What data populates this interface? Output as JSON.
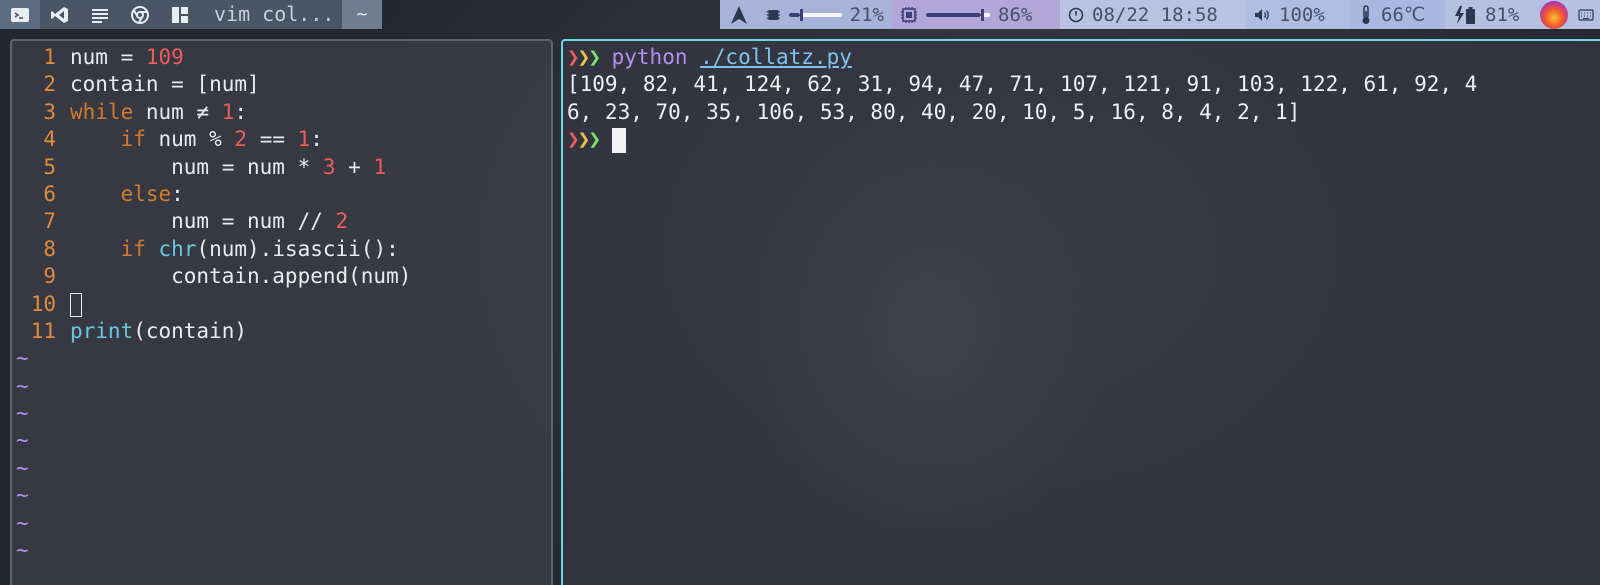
{
  "topbar": {
    "left_icons": [
      "terminal-icon",
      "vscode-icon",
      "notes-icon",
      "chrome-icon",
      "layout-icon"
    ],
    "window_title": "vim col...",
    "home_label": "~",
    "mem_percent": "21%",
    "mem_level": 0.21,
    "cpu_percent": "86%",
    "cpu_level": 0.86,
    "datetime": "08/22 18:58",
    "volume": "100%",
    "temperature": "66℃",
    "battery": "81%"
  },
  "vim": {
    "lines": [
      {
        "n": "1",
        "tokens": [
          [
            "",
            "num = "
          ],
          [
            "num",
            "109"
          ]
        ]
      },
      {
        "n": "2",
        "tokens": [
          [
            "",
            "contain = [num]"
          ]
        ]
      },
      {
        "n": "3",
        "tokens": [
          [
            "kw",
            "while"
          ],
          [
            "",
            " num ≠ "
          ],
          [
            "num",
            "1"
          ],
          [
            "",
            ":"
          ]
        ]
      },
      {
        "n": "4",
        "tokens": [
          [
            "",
            "    "
          ],
          [
            "kw",
            "if"
          ],
          [
            "",
            " num % "
          ],
          [
            "num",
            "2"
          ],
          [
            "",
            " == "
          ],
          [
            "num",
            "1"
          ],
          [
            "",
            ":"
          ]
        ]
      },
      {
        "n": "5",
        "tokens": [
          [
            "",
            "        num = num * "
          ],
          [
            "num",
            "3"
          ],
          [
            "",
            " + "
          ],
          [
            "num",
            "1"
          ]
        ]
      },
      {
        "n": "6",
        "tokens": [
          [
            "",
            "    "
          ],
          [
            "kw",
            "else"
          ],
          [
            "",
            ":"
          ]
        ]
      },
      {
        "n": "7",
        "tokens": [
          [
            "",
            "        num = num // "
          ],
          [
            "num",
            "2"
          ]
        ]
      },
      {
        "n": "8",
        "tokens": [
          [
            "",
            "    "
          ],
          [
            "kw",
            "if"
          ],
          [
            "",
            " "
          ],
          [
            "fn",
            "chr"
          ],
          [
            "",
            "(num).isascii():"
          ]
        ]
      },
      {
        "n": "9",
        "tokens": [
          [
            "",
            "        contain.append(num)"
          ]
        ]
      },
      {
        "n": "10",
        "tokens": [
          [
            "cursor",
            ""
          ]
        ]
      },
      {
        "n": "11",
        "tokens": [
          [
            "fn",
            "print"
          ],
          [
            "",
            "(contain)"
          ]
        ]
      }
    ],
    "tilde_lines": [
      "~",
      "~",
      "~",
      "~",
      "~",
      "~",
      "~",
      "~"
    ]
  },
  "terminal": {
    "prompt": "❯❯❯",
    "command": "python",
    "argument": "./collatz.py",
    "output_line1": "[109, 82, 41, 124, 62, 31, 94, 47, 71, 107, 121, 91, 103, 122, 61, 92, 4",
    "output_line2": "6, 23, 70, 35, 106, 53, 80, 40, 20, 10, 5, 16, 8, 4, 2, 1]"
  }
}
